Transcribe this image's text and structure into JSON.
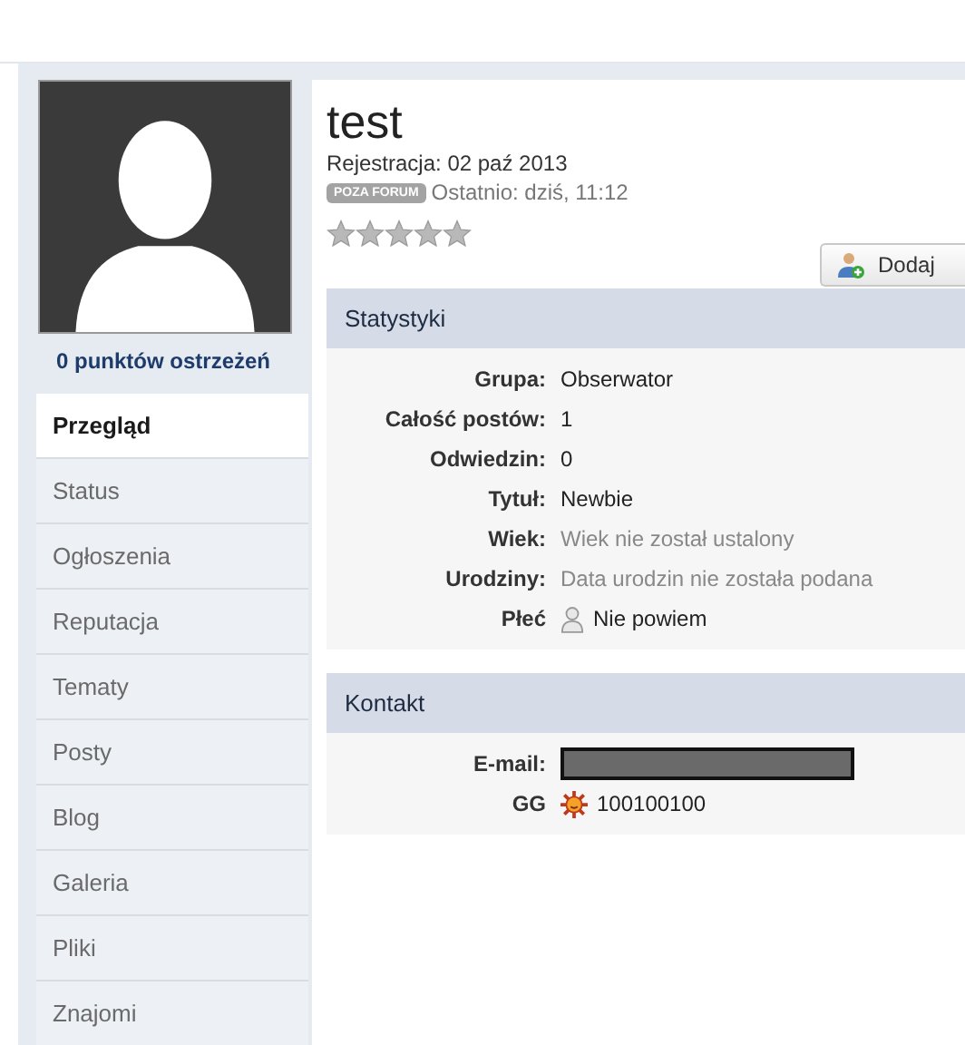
{
  "profile": {
    "name": "test",
    "registered": "Rejestracja: 02 paź 2013",
    "status_badge": "POZA FORUM",
    "last_seen": "Ostatnio: dziś, 11:12",
    "stars": 0,
    "warnings": "0 punktów ostrzeżeń",
    "add_button": "Dodaj"
  },
  "tabs": [
    {
      "label": "Przegląd",
      "selected": true
    },
    {
      "label": "Status",
      "selected": false
    },
    {
      "label": "Ogłoszenia",
      "selected": false
    },
    {
      "label": "Reputacja",
      "selected": false
    },
    {
      "label": "Tematy",
      "selected": false
    },
    {
      "label": "Posty",
      "selected": false
    },
    {
      "label": "Blog",
      "selected": false
    },
    {
      "label": "Galeria",
      "selected": false
    },
    {
      "label": "Pliki",
      "selected": false
    },
    {
      "label": "Znajomi",
      "selected": false
    }
  ],
  "sections": [
    {
      "title": "Statystyki",
      "rows": [
        {
          "label": "Grupa:",
          "value": "Obserwator",
          "kind": "text"
        },
        {
          "label": "Całość postów:",
          "value": "1",
          "kind": "text"
        },
        {
          "label": "Odwiedzin:",
          "value": "0",
          "kind": "text"
        },
        {
          "label": "Tytuł:",
          "value": "Newbie",
          "kind": "text"
        },
        {
          "label": "Wiek:",
          "value": "Wiek nie został ustalony",
          "kind": "muted"
        },
        {
          "label": "Urodziny:",
          "value": "Data urodzin nie została podana",
          "kind": "muted"
        },
        {
          "label": "Płeć",
          "value": "Nie powiem",
          "kind": "gender"
        }
      ]
    },
    {
      "title": "Kontakt",
      "rows": [
        {
          "label": "E-mail:",
          "kind": "redacted"
        },
        {
          "label": "GG",
          "value": "100100100",
          "kind": "gg"
        }
      ]
    }
  ]
}
